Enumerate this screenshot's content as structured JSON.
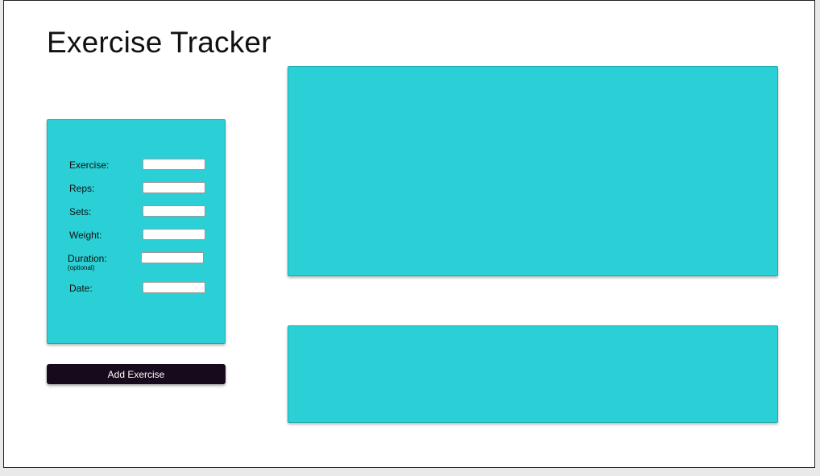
{
  "page": {
    "title": "Exercise Tracker"
  },
  "form": {
    "fields": [
      {
        "label": "Exercise:",
        "value": ""
      },
      {
        "label": "Reps:",
        "value": ""
      },
      {
        "label": "Sets:",
        "value": ""
      },
      {
        "label": "Weight:",
        "value": ""
      },
      {
        "label": "Duration:",
        "sublabel": "(optional)",
        "value": ""
      },
      {
        "label": "Date:",
        "value": ""
      }
    ]
  },
  "actions": {
    "add_label": "Add Exercise"
  },
  "colors": {
    "accent": "#2ad0d6",
    "button": "#160a1c"
  }
}
